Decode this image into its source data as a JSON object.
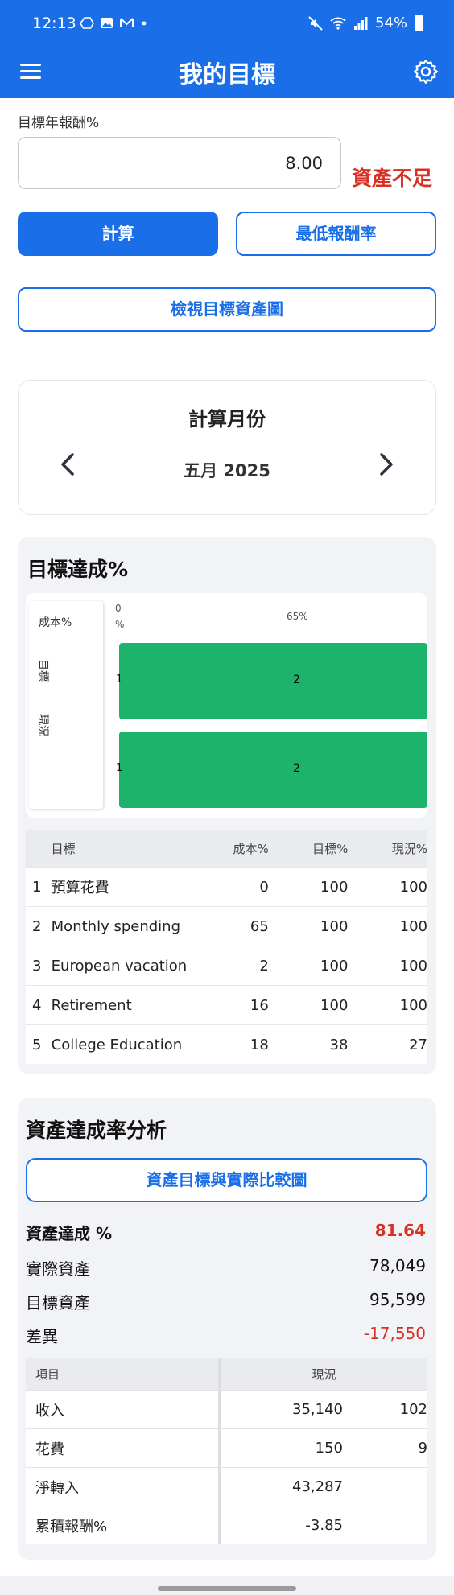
{
  "status_bar": {
    "time": "12:13",
    "battery": "54%",
    "left_icons": [
      "drive-icon",
      "image-icon",
      "gmail-icon",
      "dot-icon"
    ],
    "right_icons": [
      "mute-icon",
      "wifi-icon",
      "signal-icon",
      "battery-icon"
    ]
  },
  "app_bar": {
    "title": "我的目標",
    "menu_icon": "menu-icon",
    "settings_icon": "gear-icon"
  },
  "return_input": {
    "label": "目標年報酬%",
    "value": "8.00",
    "warning": "資產不足"
  },
  "buttons": {
    "calculate": "計算",
    "min_return": "最低報酬率",
    "view_chart": "檢視目標資產圖"
  },
  "month_card": {
    "title": "計算月份",
    "month": "五月 2025"
  },
  "goal_achievement": {
    "title": "目標達成%",
    "legend_labels": [
      "成本%",
      "目標",
      "現況"
    ],
    "chart_axis_labels": [
      "0",
      "%",
      "65%"
    ],
    "bar_labels_left": [
      "1",
      "1"
    ],
    "bar_labels_center": [
      "2",
      "2"
    ],
    "bar_color": "#1db36a"
  },
  "goals_table": {
    "headers": [
      "目標",
      "成本%",
      "目標%",
      "現況%"
    ],
    "rows": [
      {
        "idx": "1",
        "name": "預算花費",
        "cost": "0",
        "target": "100",
        "current": "100"
      },
      {
        "idx": "2",
        "name": "Monthly spending",
        "cost": "65",
        "target": "100",
        "current": "100"
      },
      {
        "idx": "3",
        "name": "European vacation",
        "cost": "2",
        "target": "100",
        "current": "100"
      },
      {
        "idx": "4",
        "name": "Retirement",
        "cost": "16",
        "target": "100",
        "current": "100"
      },
      {
        "idx": "5",
        "name": "College Education",
        "cost": "18",
        "target": "38",
        "current": "27"
      }
    ]
  },
  "asset_analysis": {
    "title": "資產達成率分析",
    "compare_button": "資產目標與實際比較圖",
    "achievement_label": "資產達成 %",
    "achievement_value": "81.64",
    "actual_label": "實際資產",
    "actual_value": "78,049",
    "target_label": "目標資產",
    "target_value": "95,599",
    "diff_label": "差異",
    "diff_value": "-17,550",
    "accent_red": "#d93025"
  },
  "asset_table": {
    "headers": [
      "項目",
      "現況"
    ],
    "rows": [
      {
        "item": "收入",
        "current": "35,140",
        "next": "102"
      },
      {
        "item": "花費",
        "current": "150",
        "next": "9"
      },
      {
        "item": "淨轉入",
        "current": "43,287",
        "next": ""
      },
      {
        "item": "累積報酬%",
        "current": "-3.85",
        "next": ""
      }
    ]
  }
}
